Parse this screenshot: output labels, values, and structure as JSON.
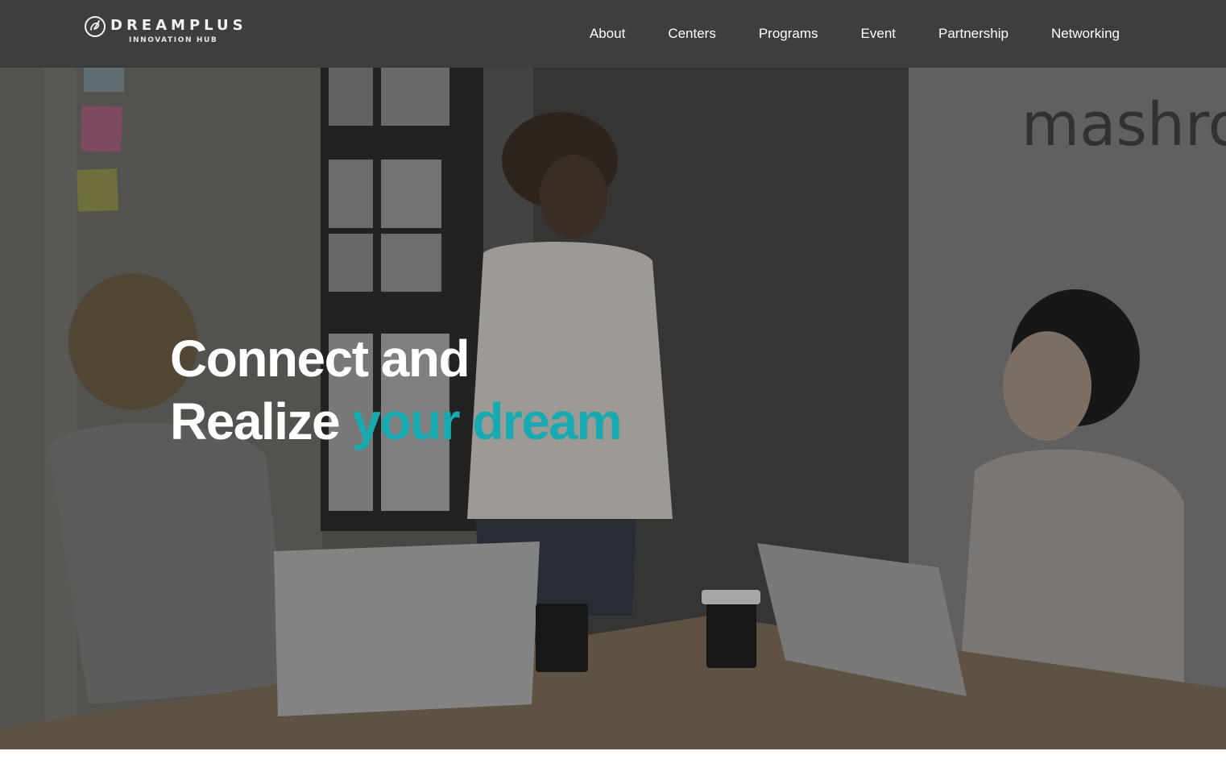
{
  "header": {
    "logo": {
      "wordmark": "DREAMPLUS",
      "subtitle": "INNOVATION HUB",
      "icon": "dreamplus-logo-icon"
    },
    "nav": [
      {
        "label": "About"
      },
      {
        "label": "Centers"
      },
      {
        "label": "Programs"
      },
      {
        "label": "Event"
      },
      {
        "label": "Partnership"
      },
      {
        "label": "Networking"
      }
    ]
  },
  "hero": {
    "headline_line1": "Connect and",
    "headline_line2_plain": "Realize",
    "headline_line2_accent": "your dream",
    "wall_sign": "mashro",
    "accent_color": "#17aab0",
    "image_description_icon": "office-meeting-photo"
  },
  "colors": {
    "header_bg": "#3e3e3e",
    "accent": "#17aab0"
  }
}
